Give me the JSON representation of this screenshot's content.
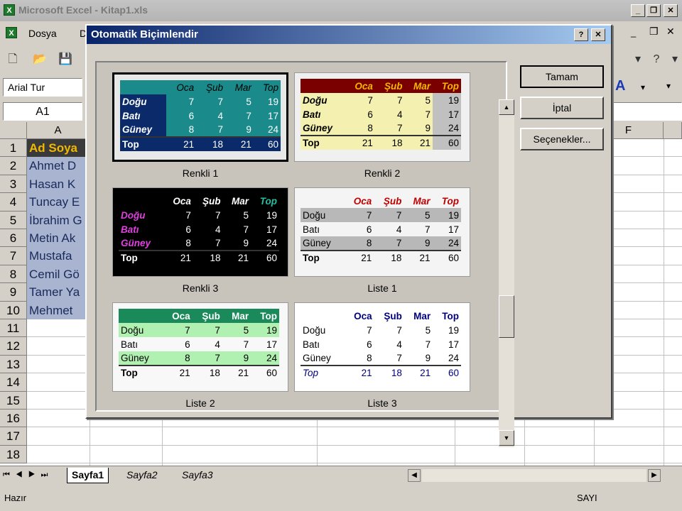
{
  "app": {
    "title": "Microsoft Excel - Kitap1.xls",
    "icon_label": "X"
  },
  "menu": {
    "file": "Dosya",
    "edit_initial": "D"
  },
  "format_bar": {
    "font": "Arial Tur"
  },
  "name_box": "A1",
  "columns": [
    "A",
    "F"
  ],
  "rows": [
    "1",
    "2",
    "3",
    "4",
    "5",
    "6",
    "7",
    "8",
    "9",
    "10",
    "11",
    "12",
    "13",
    "14",
    "15",
    "16",
    "17",
    "18"
  ],
  "cells_a": [
    "Ad Soya",
    "Ahmet D",
    "Hasan K",
    "Tuncay E",
    "İbrahim G",
    "Metin Ak",
    "Mustafa",
    "Cemil Gö",
    "Tamer Ya",
    "Mehmet"
  ],
  "tabs": [
    "Sayfa1",
    "Sayfa2",
    "Sayfa3"
  ],
  "status": {
    "left": "Hazır",
    "right": "SAYI"
  },
  "dialog": {
    "title": "Otomatik Biçimlendir",
    "buttons": {
      "ok": "Tamam",
      "cancel": "İptal",
      "options": "Seçenekler..."
    },
    "title_help": "?",
    "title_close": "✕",
    "samples": [
      {
        "caption": "Renkli 1"
      },
      {
        "caption": "Renkli 2"
      },
      {
        "caption": "Renkli 3"
      },
      {
        "caption": "Liste 1"
      },
      {
        "caption": "Liste 2"
      },
      {
        "caption": "Liste 3"
      }
    ],
    "table": {
      "headers": [
        "Oca",
        "Şub",
        "Mar",
        "Top"
      ],
      "rows": [
        {
          "label": "Doğu",
          "values": [
            "7",
            "7",
            "5",
            "19"
          ]
        },
        {
          "label": "Batı",
          "values": [
            "6",
            "4",
            "7",
            "17"
          ]
        },
        {
          "label": "Güney",
          "values": [
            "8",
            "7",
            "9",
            "24"
          ]
        },
        {
          "label": "Top",
          "values": [
            "21",
            "18",
            "21",
            "60"
          ]
        }
      ]
    }
  },
  "colors": {
    "dialog_title": "#0a246a",
    "renkli1_bg": "#1a8a8a",
    "renkli2_header": "#7a0000",
    "renkli2_body": "#f4f0b0",
    "renkli3_bg": "#000000",
    "liste2_header": "#1a8a5a"
  }
}
